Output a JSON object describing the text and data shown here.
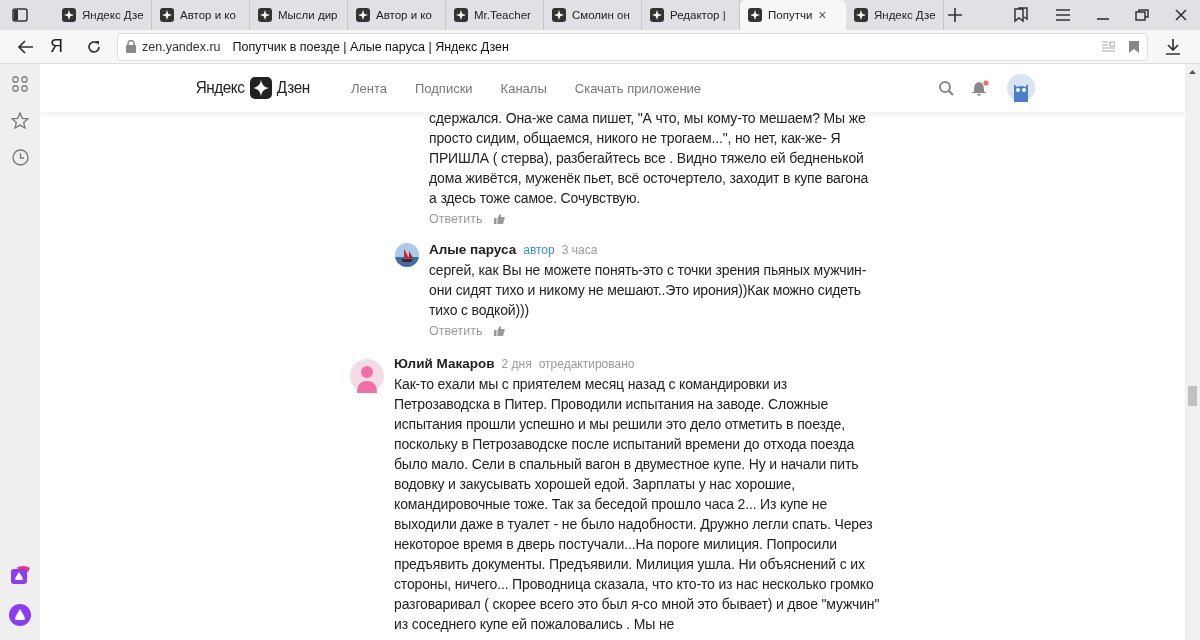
{
  "browser": {
    "tabs": [
      {
        "title": "Яндекс Дзе",
        "selected": false
      },
      {
        "title": "Автор и ко",
        "selected": false
      },
      {
        "title": "Мысли дир",
        "selected": false
      },
      {
        "title": "Автор и ко",
        "selected": false
      },
      {
        "title": "Mr.Teacher",
        "selected": false
      },
      {
        "title": "Смолин он",
        "selected": false
      },
      {
        "title": "Редактор |",
        "selected": false
      },
      {
        "title": "Попутчи",
        "selected": true
      },
      {
        "title": "Яндекс Дзе",
        "selected": false
      }
    ],
    "close_tab": "×",
    "browser_logo": "Я",
    "url": "zen.yandex.ru",
    "page_title": "Попутчик в поезде | Алые паруса | Яндекс Дзен"
  },
  "header": {
    "logo_left": "Яндекс",
    "logo_right": "Дзен",
    "nav": [
      "Лента",
      "Подписки",
      "Каналы",
      "Скачать приложение"
    ],
    "notifications_unread": true
  },
  "comments": [
    {
      "kind": "reply",
      "text": "сдержался. Она-же сама пишет, \"А что, мы кому-то мешаем? Мы же просто сидим, общаемся, никого не трогаем...\", но нет, как-же- Я ПРИШЛА ( стерва), разбегайтесь все . Видно тяжело ей бедненькой дома живётся, муженёк пьет, всё осточертело, заходит в купе вагона а здесь тоже самое. Сочувствую.",
      "reply_link": "Ответить"
    },
    {
      "kind": "reply",
      "author": "Алые паруса",
      "badge": "автор",
      "time": "3 часа",
      "text": "сергей, как Вы не можете понять-это с точки зрения пьяных мужчин-они сидят тихо и никому не мешают..Это ирония))Как можно сидеть тихо с водкой)))",
      "reply_link": "Ответить"
    },
    {
      "kind": "comment",
      "author": "Юлий Макаров",
      "time": "2 дня",
      "edited": "отредактировано",
      "text": "Как-то ехали мы с приятелем месяц назад с командировки из Петрозаводска в Питер. Проводили испытания на заводе. Сложные испытания прошли успешно и мы решили это дело отметить в поезде, поскольку в Петрозаводске после испытаний времени до отхода поезда было мало. Сели в спальный вагон в двуместное купе. Ну и начали пить водовку и закусывать хорошей едой. Зарплаты у нас хорошие, командировочные тоже. Так за беседой прошло часа 2... Из купе не выходили даже в туалет - не было надобности. Дружно легли спать. Через некоторое время в дверь постучали...На пороге милиция. Попросили предъявить документы. Предъявили. Милиция ушла. Ни объяснений с их стороны, ничего... Проводница сказала, что кто-то из нас несколько громко разговаривал ( скорее всего это был я-со мной это бывает) и двое \"мужчин\" из соседнего купе ей пожаловались . Мы не"
    }
  ]
}
